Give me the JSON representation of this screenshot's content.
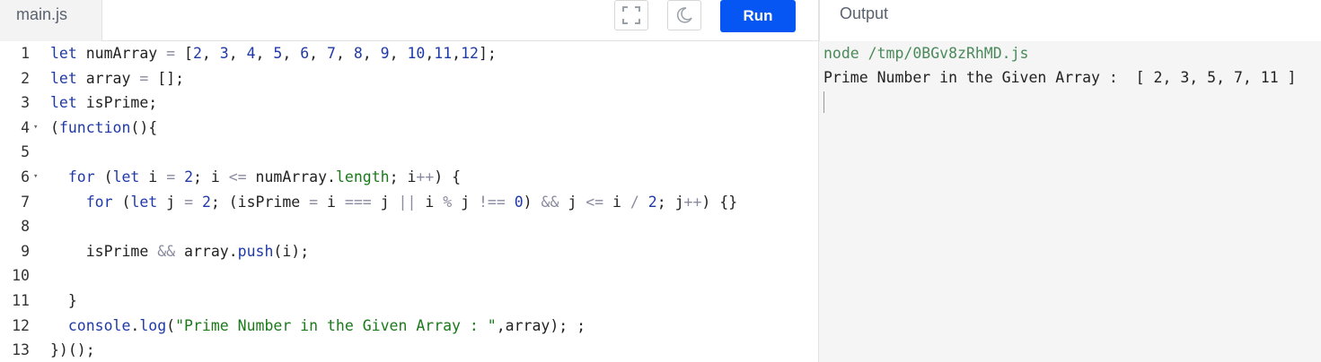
{
  "editor": {
    "tab_label": "main.js",
    "run_label": "Run",
    "lines": [
      {
        "n": "1",
        "parts": [
          [
            "kw",
            "let"
          ],
          [
            "t",
            " numArray "
          ],
          [
            "op",
            "="
          ],
          [
            "t",
            " ["
          ],
          [
            "num",
            "2"
          ],
          [
            "t",
            ", "
          ],
          [
            "num",
            "3"
          ],
          [
            "t",
            ", "
          ],
          [
            "num",
            "4"
          ],
          [
            "t",
            ", "
          ],
          [
            "num",
            "5"
          ],
          [
            "t",
            ", "
          ],
          [
            "num",
            "6"
          ],
          [
            "t",
            ", "
          ],
          [
            "num",
            "7"
          ],
          [
            "t",
            ", "
          ],
          [
            "num",
            "8"
          ],
          [
            "t",
            ", "
          ],
          [
            "num",
            "9"
          ],
          [
            "t",
            ", "
          ],
          [
            "num",
            "10"
          ],
          [
            "t",
            ","
          ],
          [
            "num",
            "11"
          ],
          [
            "t",
            ","
          ],
          [
            "num",
            "12"
          ],
          [
            "t",
            "];"
          ]
        ]
      },
      {
        "n": "2",
        "parts": [
          [
            "kw",
            "let"
          ],
          [
            "t",
            " array "
          ],
          [
            "op",
            "="
          ],
          [
            "t",
            " [];"
          ]
        ]
      },
      {
        "n": "3",
        "parts": [
          [
            "kw",
            "let"
          ],
          [
            "t",
            " isPrime;"
          ]
        ]
      },
      {
        "n": "4",
        "fold": true,
        "parts": [
          [
            "t",
            "("
          ],
          [
            "kw",
            "function"
          ],
          [
            "t",
            "(){"
          ]
        ]
      },
      {
        "n": "5",
        "parts": []
      },
      {
        "n": "6",
        "fold": true,
        "parts": [
          [
            "t",
            "  "
          ],
          [
            "kw",
            "for"
          ],
          [
            "t",
            " ("
          ],
          [
            "kw",
            "let"
          ],
          [
            "t",
            " i "
          ],
          [
            "op",
            "="
          ],
          [
            "t",
            " "
          ],
          [
            "num",
            "2"
          ],
          [
            "t",
            "; i "
          ],
          [
            "op",
            "<="
          ],
          [
            "t",
            " numArray."
          ],
          [
            "prop",
            "length"
          ],
          [
            "t",
            "; i"
          ],
          [
            "op",
            "++"
          ],
          [
            "t",
            ") {"
          ]
        ]
      },
      {
        "n": "7",
        "parts": [
          [
            "t",
            "    "
          ],
          [
            "kw",
            "for"
          ],
          [
            "t",
            " ("
          ],
          [
            "kw",
            "let"
          ],
          [
            "t",
            " j "
          ],
          [
            "op",
            "="
          ],
          [
            "t",
            " "
          ],
          [
            "num",
            "2"
          ],
          [
            "t",
            "; (isPrime "
          ],
          [
            "op",
            "="
          ],
          [
            "t",
            " i "
          ],
          [
            "op",
            "==="
          ],
          [
            "t",
            " j "
          ],
          [
            "op",
            "||"
          ],
          [
            "t",
            " i "
          ],
          [
            "op",
            "%"
          ],
          [
            "t",
            " j "
          ],
          [
            "op",
            "!=="
          ],
          [
            "t",
            " "
          ],
          [
            "num",
            "0"
          ],
          [
            "t",
            ") "
          ],
          [
            "op",
            "&&"
          ],
          [
            "t",
            " j "
          ],
          [
            "op",
            "<="
          ],
          [
            "t",
            " i "
          ],
          [
            "op",
            "/"
          ],
          [
            "t",
            " "
          ],
          [
            "num",
            "2"
          ],
          [
            "t",
            "; j"
          ],
          [
            "op",
            "++"
          ],
          [
            "t",
            ") {}"
          ]
        ]
      },
      {
        "n": "8",
        "parts": []
      },
      {
        "n": "9",
        "parts": [
          [
            "t",
            "    isPrime "
          ],
          [
            "op",
            "&&"
          ],
          [
            "t",
            " array."
          ],
          [
            "fn",
            "push"
          ],
          [
            "t",
            "(i);"
          ]
        ]
      },
      {
        "n": "10",
        "parts": []
      },
      {
        "n": "11",
        "parts": [
          [
            "t",
            "  }"
          ]
        ]
      },
      {
        "n": "12",
        "parts": [
          [
            "t",
            "  "
          ],
          [
            "fn",
            "console"
          ],
          [
            "t",
            "."
          ],
          [
            "fn",
            "log"
          ],
          [
            "t",
            "("
          ],
          [
            "str",
            "\"Prime Number in the Given Array : \""
          ],
          [
            "t",
            ",array); ;"
          ]
        ]
      },
      {
        "n": "13",
        "parts": [
          [
            "t",
            "})();"
          ]
        ]
      }
    ]
  },
  "output": {
    "header_label": "Output",
    "command": "node /tmp/0BGv8zRhMD.js",
    "result": "Prime Number in the Given Array :  [ 2, 3, 5, 7, 11 ]"
  },
  "colors": {
    "run_button": "#0556f3",
    "keyword": "#1f3aa8",
    "string": "#1a7a1a",
    "command_text": "#4a8a5a"
  },
  "icons": {
    "fullscreen": "fullscreen-icon",
    "theme": "moon-icon"
  }
}
